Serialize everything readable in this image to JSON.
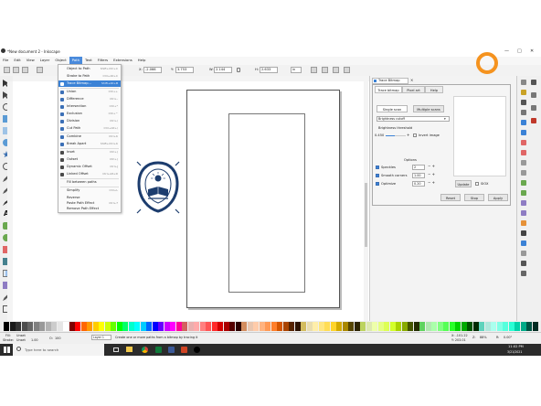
{
  "window": {
    "title": "*New document 2 - Inkscape",
    "minimize": "—",
    "maximize": "□",
    "close": "✕"
  },
  "menubar": {
    "items": [
      "File",
      "Edit",
      "View",
      "Layer",
      "Object",
      "Path",
      "Text",
      "Filters",
      "Extensions",
      "Help"
    ],
    "active": "Path"
  },
  "toolctrl": {
    "x_label": "X:",
    "x_value": "-2.066",
    "y_label": "Y:",
    "y_value": "3.753",
    "w_label": "W:",
    "w_value": "2.144",
    "h_label": "H:",
    "h_value": "2.633",
    "unit": "in"
  },
  "path_menu": {
    "items": [
      {
        "label": "Object to Path",
        "shortcut": "Shift+Ctrl+C",
        "icon_color": "#777777"
      },
      {
        "label": "Stroke to Path",
        "shortcut": "Ctrl+Alt+C",
        "icon_color": "#777777"
      },
      {
        "label": "Trace Bitmap...",
        "shortcut": "Shift+Alt+B",
        "icon_color": "#5a8fd6",
        "highlighted": true
      },
      {
        "label": "Union",
        "shortcut": "Ctrl++",
        "icon_color": "#3b6fb6"
      },
      {
        "label": "Difference",
        "shortcut": "Ctrl+-",
        "icon_color": "#3b6fb6"
      },
      {
        "label": "Intersection",
        "shortcut": "Ctrl+*",
        "icon_color": "#3b6fb6"
      },
      {
        "label": "Exclusion",
        "shortcut": "Ctrl+^",
        "icon_color": "#3b6fb6"
      },
      {
        "label": "Division",
        "shortcut": "Ctrl+/",
        "icon_color": "#3b6fb6"
      },
      {
        "label": "Cut Path",
        "shortcut": "Ctrl+Alt+/",
        "icon_color": "#3b6fb6"
      },
      {
        "label": "Combine",
        "shortcut": "Ctrl+K",
        "icon_color": "#3b6fb6"
      },
      {
        "label": "Break Apart",
        "shortcut": "Shift+Ctrl+K",
        "icon_color": "#3b6fb6"
      },
      {
        "label": "Inset",
        "shortcut": "Ctrl+(",
        "icon_color": "#4a4a4a"
      },
      {
        "label": "Outset",
        "shortcut": "Ctrl+)",
        "icon_color": "#4a4a4a"
      },
      {
        "label": "Dynamic Offset",
        "shortcut": "Ctrl+J",
        "icon_color": "#4a4a4a"
      },
      {
        "label": "Linked Offset",
        "shortcut": "Ctrl+Alt+D",
        "icon_color": "#4a4a4a"
      },
      {
        "label": "Fill between paths",
        "shortcut": "",
        "icon_color": ""
      },
      {
        "label": "Simplify",
        "shortcut": "Ctrl+L",
        "icon_color": ""
      },
      {
        "label": "Reverse",
        "shortcut": "",
        "icon_color": ""
      },
      {
        "label": "Path Effects...",
        "shortcut": "Ctrl+&",
        "icon_color": ""
      },
      {
        "label": "Paste Path Effect",
        "shortcut": "Ctrl+7",
        "icon_color": ""
      },
      {
        "label": "Remove Path Effect",
        "shortcut": "",
        "icon_color": ""
      }
    ]
  },
  "trace_panel": {
    "tab_title": "Trace Bitmap",
    "tab_close": "×",
    "tabs": [
      "Trace bitmap",
      "Pixel art",
      "Help"
    ],
    "mode_buttons": [
      "Single scan",
      "Multiple scans"
    ],
    "mode_select": "Brightness cutoff",
    "threshold_label": "Brightness threshold",
    "threshold_value": "0.450",
    "invert_label": "Invert image",
    "options_title": "Options",
    "speckles_label": "Speckles",
    "speckles_value": "2",
    "smooth_label": "Smooth corners",
    "smooth_value": "1.00",
    "optimize_label": "Optimize",
    "optimize_value": "0.20",
    "update_label": "Update",
    "sioX_label": "SIOX",
    "reset_label": "Reset",
    "stop_label": "Stop",
    "apply_label": "Apply"
  },
  "statusbar": {
    "fill_label": "Fill:",
    "fill_value": "Unset",
    "stroke_label": "Stroke:",
    "stroke_value": "Unset",
    "stroke_width": "1.00",
    "opacity_label": "O:",
    "opacity_value": "100",
    "layer_value": "Layer 1",
    "message": "Create one or more paths from a bitmap by tracing it",
    "x_readout": "X: -101.22",
    "y_readout": "Y: 203.01",
    "zoom_label": "Z:",
    "zoom_value": "88%",
    "rotation_label": "R:",
    "rotation_value": "0.00°"
  },
  "taskbar": {
    "search_placeholder": "Type here to search",
    "time": "11:02 PM",
    "date": "3/21/2021"
  },
  "colors": {
    "accent": "#3b82d6",
    "highlight_ring": "#f5931f",
    "logo_blue": "#1d3d6e"
  }
}
